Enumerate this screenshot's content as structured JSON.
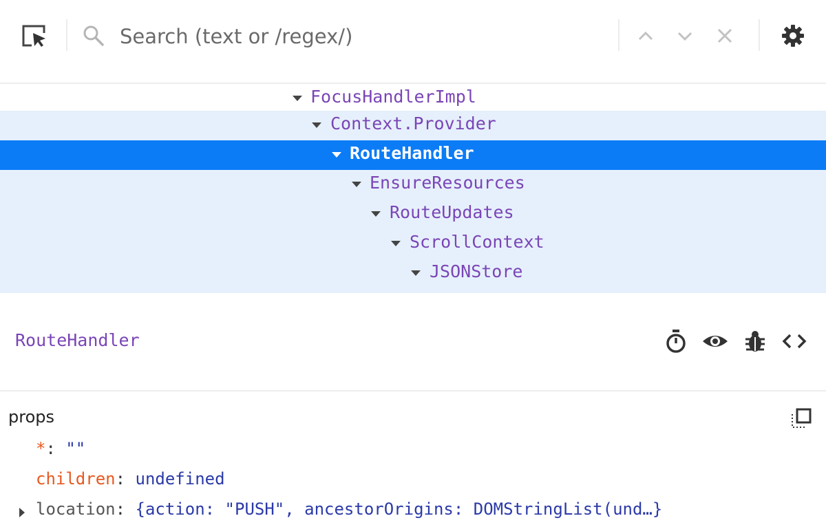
{
  "toolbar": {
    "inspect_icon": "select-element-icon",
    "search_placeholder": "Search (text or /regex/)",
    "prev_icon": "chevron-up-icon",
    "next_icon": "chevron-down-icon",
    "clear_icon": "close-icon",
    "settings_icon": "gear-icon"
  },
  "tree": {
    "rows": [
      {
        "label": "FocusHandlerImpl",
        "state": "normal"
      },
      {
        "label": "Context.Provider",
        "state": "highlighted"
      },
      {
        "label": "RouteHandler",
        "state": "selected"
      },
      {
        "label": "EnsureResources",
        "state": "highlighted"
      },
      {
        "label": "RouteUpdates",
        "state": "highlighted"
      },
      {
        "label": "ScrollContext",
        "state": "highlighted"
      },
      {
        "label": "JSONStore",
        "state": "highlighted"
      }
    ]
  },
  "detail": {
    "component_name": "RouteHandler",
    "icons": [
      "stopwatch-icon",
      "eye-icon",
      "bug-icon",
      "source-code-icon"
    ]
  },
  "props": {
    "title": "props",
    "copy_icon": "copy-icon",
    "items": [
      {
        "key": "*",
        "colon": ":",
        "value": "\"\""
      },
      {
        "key": "children",
        "colon": ":",
        "value": "undefined"
      },
      {
        "key": "location",
        "colon": ":",
        "value": "{action: \"PUSH\", ancestorOrigins: DOMStringList(und…}"
      }
    ]
  },
  "colors": {
    "selected_row": "#0b7cf6",
    "highlight_row": "#e6f0fc",
    "component_name": "#7a45b6",
    "prop_key": "#e8591f",
    "prop_value": "#2b3aa8"
  }
}
